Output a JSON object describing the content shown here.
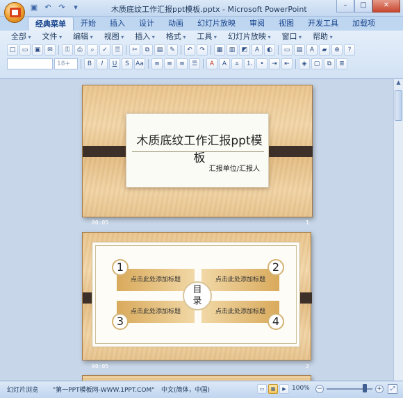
{
  "window": {
    "title": "木质底纹工作汇报ppt模板.pptx - Microsoft PowerPoint",
    "minimize": "–",
    "maximize": "□",
    "close": "✕"
  },
  "qat": [
    "save-icon",
    "undo-icon",
    "redo-icon",
    "customize-icon"
  ],
  "tabs": [
    "经典菜单",
    "开始",
    "插入",
    "设计",
    "动画",
    "幻灯片放映",
    "审阅",
    "视图",
    "开发工具",
    "加载项"
  ],
  "menus": [
    "全部",
    "文件",
    "编辑",
    "视图",
    "插入",
    "格式",
    "工具",
    "幻灯片放映",
    "窗口",
    "帮助"
  ],
  "font_size": "18+",
  "toolbar_row2_labels": [
    "B",
    "I",
    "U",
    "S",
    "Aa",
    "A",
    "A",
    "A"
  ],
  "slides": [
    {
      "title": "木质底纹工作汇报ppt模板",
      "subtitle": "汇报单位/汇报人",
      "time": "00:05",
      "number": "1"
    },
    {
      "center": "目录",
      "center_line1": "目",
      "center_line2": "录",
      "items": [
        {
          "num": "1",
          "label": "点击此处添加标题"
        },
        {
          "num": "2",
          "label": "点击此处添加标题"
        },
        {
          "num": "3",
          "label": "点击此处添加标题"
        },
        {
          "num": "4",
          "label": "点击此处添加标题"
        }
      ],
      "time": "00:05",
      "number": "2"
    }
  ],
  "status": {
    "view_name": "幻灯片浏览",
    "theme": "\"第一PPT模板网-WWW.1PPT.COM\"",
    "language": "中文(简体，中国)",
    "zoom": "100%",
    "zoom_minus": "−",
    "zoom_plus": "+"
  },
  "colors": {
    "ribbon": "#d2e2f4",
    "accent": "#15428b",
    "wood": "#e9c48d",
    "band": "#3d3028"
  }
}
